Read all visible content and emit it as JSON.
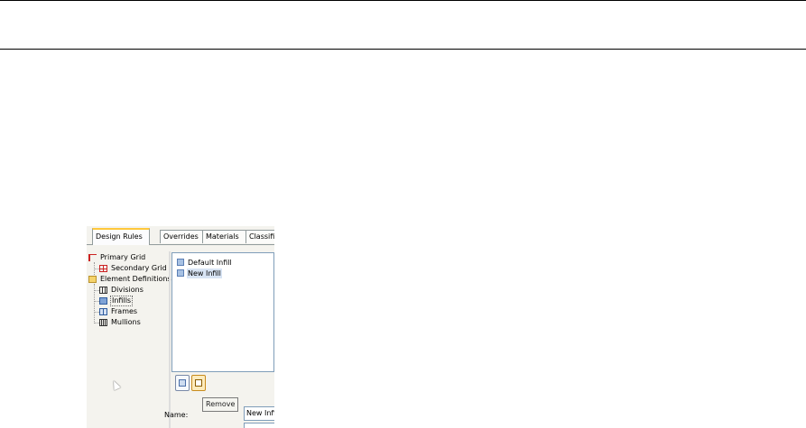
{
  "tabs": [
    {
      "label": "Design Rules",
      "active": true
    },
    {
      "label": "Overrides",
      "active": false
    },
    {
      "label": "Materials",
      "active": false
    },
    {
      "label": "Classifications",
      "active": false
    }
  ],
  "tree": {
    "items": [
      {
        "label": "Primary Grid",
        "icon": "primary-grid-icon"
      },
      {
        "label": "Secondary Grid",
        "icon": "secondary-grid-icon"
      },
      {
        "label": "Element Definitions",
        "icon": "folder-icon"
      },
      {
        "label": "Divisions",
        "icon": "divisions-icon"
      },
      {
        "label": "Infills",
        "icon": "infill-icon",
        "selected": true
      },
      {
        "label": "Frames",
        "icon": "frames-icon"
      },
      {
        "label": "Mullions",
        "icon": "mullions-icon"
      }
    ]
  },
  "list": {
    "items": [
      {
        "label": "Default Infill",
        "icon": "infill-icon"
      },
      {
        "label": "New Infill",
        "icon": "infill-icon",
        "selected": true
      }
    ]
  },
  "toolbar": {
    "add_icon": "add-icon",
    "remove_icon": "remove-icon",
    "tooltip": "Remove"
  },
  "properties": {
    "name_label": "Name:",
    "name_value": "New Infi"
  },
  "colors": {
    "active_tab_accent": "#ffc83c",
    "panel_background": "#f4f3ee",
    "selection": "#d8e4f4"
  }
}
